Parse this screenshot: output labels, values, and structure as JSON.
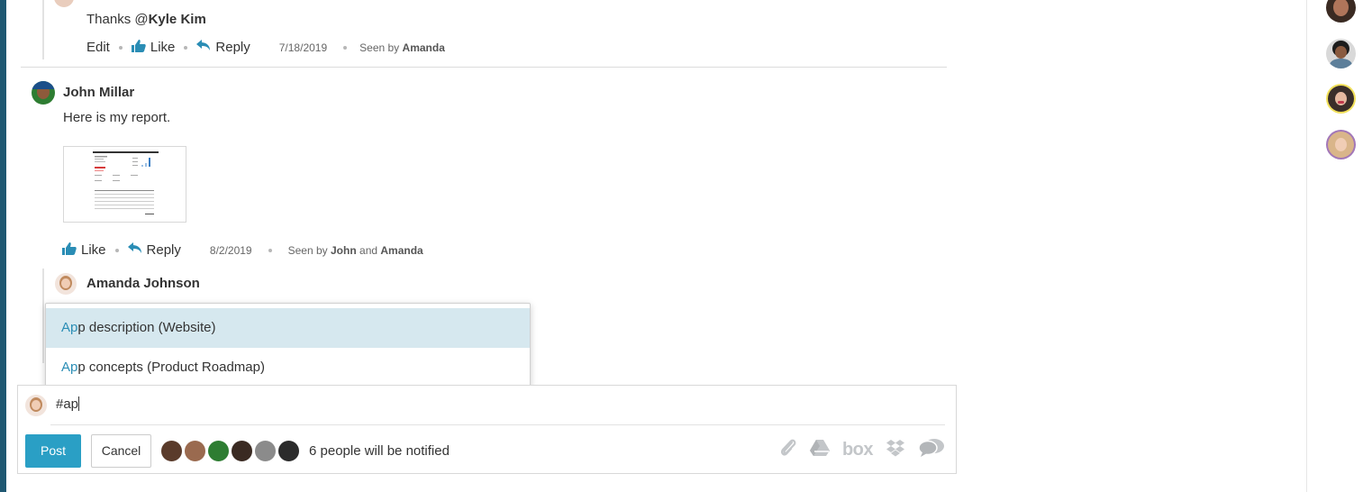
{
  "thread": {
    "reply1": {
      "text_prefix": "Thanks @",
      "mention": "Kyle Kim",
      "actions": {
        "edit": "Edit",
        "like": "Like",
        "reply": "Reply",
        "date": "7/18/2019",
        "seen_prefix": "Seen by",
        "seen_names": "Amanda"
      }
    },
    "post": {
      "author": "John Millar",
      "text": "Here is my report.",
      "actions": {
        "like": "Like",
        "reply": "Reply",
        "date": "8/2/2019",
        "seen_prefix": "Seen by",
        "seen_name1": "John",
        "seen_and": "and",
        "seen_name2": "Amanda"
      }
    },
    "reply2": {
      "author": "Amanda Johnson"
    }
  },
  "suggestions": {
    "items": [
      {
        "match": "Ap",
        "rest": "p description (Website)",
        "active": true
      },
      {
        "match": "Ap",
        "rest": "p concepts (Product Roadmap)",
        "active": false
      }
    ]
  },
  "composer": {
    "input_value": "#ap",
    "post_label": "Post",
    "cancel_label": "Cancel",
    "notify_text": "6 people will be notified",
    "tools": [
      "attach-icon",
      "google-drive-icon",
      "box-icon",
      "dropbox-icon",
      "chat-icon"
    ],
    "box_label": "box"
  },
  "colors": {
    "accent": "#2a9fc5",
    "link": "#2a8db5",
    "active_row": "#d6e8ef",
    "sidebar": "#1f5872"
  }
}
